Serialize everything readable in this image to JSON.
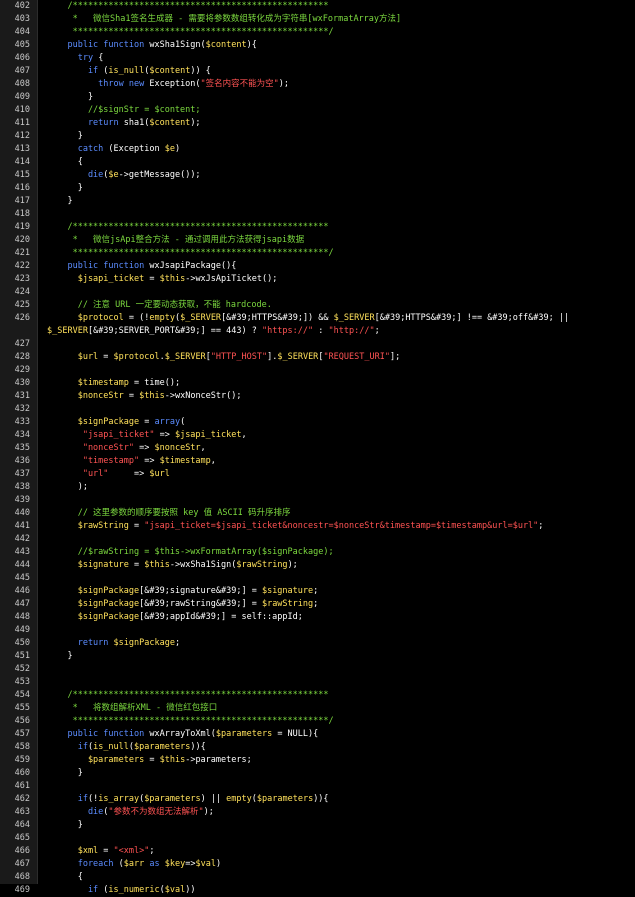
{
  "editor": {
    "language": "php",
    "colors": {
      "background": "#000000",
      "gutter": "#1a1a1a",
      "line_number": "#c8c8c8",
      "plain": "#ffffff",
      "comment": "#7cd93f",
      "keyword": "#5b8cff",
      "variable": "#ffe15b",
      "string": "#ff5353"
    },
    "lines": [
      {
        "n": "402",
        "tokens": [
          [
            "c",
            "    /**************************************************"
          ]
        ]
      },
      {
        "n": "403",
        "tokens": [
          [
            "c",
            "     *   微信Sha1签名生成器 - 需要将参数数组转化成为字符串[wxFormatArray方法]"
          ]
        ]
      },
      {
        "n": "404",
        "tokens": [
          [
            "c",
            "     **************************************************/"
          ]
        ]
      },
      {
        "n": "405",
        "tokens": [
          [
            "k",
            "    public function "
          ],
          [
            "p",
            "wxSha1Sign("
          ],
          [
            "v",
            "$content"
          ],
          [
            "p",
            "){"
          ]
        ]
      },
      {
        "n": "406",
        "tokens": [
          [
            "k",
            "      try "
          ],
          [
            "p",
            "{"
          ]
        ]
      },
      {
        "n": "407",
        "tokens": [
          [
            "k",
            "        if "
          ],
          [
            "p",
            "("
          ],
          [
            "v",
            "is_null"
          ],
          [
            "p",
            "("
          ],
          [
            "v",
            "$content"
          ],
          [
            "p",
            ")) {"
          ]
        ]
      },
      {
        "n": "408",
        "tokens": [
          [
            "k",
            "          throw new "
          ],
          [
            "p",
            "Exception("
          ],
          [
            "s",
            "\"签名内容不能为空\""
          ],
          [
            "p",
            ");"
          ]
        ]
      },
      {
        "n": "409",
        "tokens": [
          [
            "p",
            "        }"
          ]
        ]
      },
      {
        "n": "410",
        "tokens": [
          [
            "c",
            "        //$signStr = $content;"
          ]
        ]
      },
      {
        "n": "411",
        "tokens": [
          [
            "k",
            "        return "
          ],
          [
            "p",
            "sha1("
          ],
          [
            "v",
            "$content"
          ],
          [
            "p",
            ");"
          ]
        ]
      },
      {
        "n": "412",
        "tokens": [
          [
            "p",
            "      }"
          ]
        ]
      },
      {
        "n": "413",
        "tokens": [
          [
            "k",
            "      catch "
          ],
          [
            "p",
            "(Exception "
          ],
          [
            "v",
            "$e"
          ],
          [
            "p",
            ")"
          ]
        ]
      },
      {
        "n": "414",
        "tokens": [
          [
            "p",
            "      {"
          ]
        ]
      },
      {
        "n": "415",
        "tokens": [
          [
            "k",
            "        die"
          ],
          [
            "p",
            "("
          ],
          [
            "v",
            "$e"
          ],
          [
            "p",
            "->getMessage());"
          ]
        ]
      },
      {
        "n": "416",
        "tokens": [
          [
            "p",
            "      }"
          ]
        ]
      },
      {
        "n": "417",
        "tokens": [
          [
            "p",
            "    }"
          ]
        ]
      },
      {
        "n": "418",
        "tokens": []
      },
      {
        "n": "419",
        "tokens": [
          [
            "c",
            "    /**************************************************"
          ]
        ]
      },
      {
        "n": "420",
        "tokens": [
          [
            "c",
            "     *   微信jsApi整合方法 - 通过调用此方法获得jsapi数据"
          ]
        ]
      },
      {
        "n": "421",
        "tokens": [
          [
            "c",
            "     **************************************************/"
          ]
        ]
      },
      {
        "n": "422",
        "tokens": [
          [
            "k",
            "    public function "
          ],
          [
            "p",
            "wxJsapiPackage(){"
          ]
        ]
      },
      {
        "n": "423",
        "tokens": [
          [
            "v",
            "      $jsapi_ticket "
          ],
          [
            "p",
            "= "
          ],
          [
            "v",
            "$this"
          ],
          [
            "p",
            "->wxJsApiTicket();"
          ]
        ]
      },
      {
        "n": "424",
        "tokens": []
      },
      {
        "n": "425",
        "tokens": [
          [
            "c",
            "      // 注意 URL 一定要动态获取，不能 hardcode."
          ]
        ]
      },
      {
        "n": "426",
        "wrap": true,
        "tokens": [
          [
            "v",
            "      $protocol "
          ],
          [
            "p",
            "= (!"
          ],
          [
            "v",
            "empty"
          ],
          [
            "p",
            "("
          ],
          [
            "v",
            "$_SERVER"
          ],
          [
            "p",
            "[&#39;HTTPS&#39;]) && "
          ],
          [
            "v",
            "$_SERVER"
          ],
          [
            "p",
            "[&#39;HTTPS&#39;] !== &#39;off&#39; || "
          ],
          [
            "v",
            "$_SERVER"
          ],
          [
            "p",
            "[&#39;SERVER_PORT&#39;] == 443) ? "
          ],
          [
            "s",
            "\"https://\""
          ],
          [
            "p",
            " : "
          ],
          [
            "s",
            "\"http://\""
          ],
          [
            "p",
            ";"
          ]
        ]
      },
      {
        "n": "427",
        "tokens": []
      },
      {
        "n": "428",
        "tokens": [
          [
            "v",
            "      $url "
          ],
          [
            "p",
            "= "
          ],
          [
            "v",
            "$protocol"
          ],
          [
            "p",
            "."
          ],
          [
            "v",
            "$_SERVER"
          ],
          [
            "p",
            "["
          ],
          [
            "s",
            "\"HTTP_HOST\""
          ],
          [
            "p",
            "]."
          ],
          [
            "v",
            "$_SERVER"
          ],
          [
            "p",
            "["
          ],
          [
            "s",
            "\"REQUEST_URI\""
          ],
          [
            "p",
            "];"
          ]
        ]
      },
      {
        "n": "429",
        "tokens": []
      },
      {
        "n": "430",
        "tokens": [
          [
            "v",
            "      $timestamp "
          ],
          [
            "p",
            "= time();"
          ]
        ]
      },
      {
        "n": "431",
        "tokens": [
          [
            "v",
            "      $nonceStr "
          ],
          [
            "p",
            "= "
          ],
          [
            "v",
            "$this"
          ],
          [
            "p",
            "->wxNonceStr();"
          ]
        ]
      },
      {
        "n": "432",
        "tokens": []
      },
      {
        "n": "433",
        "tokens": [
          [
            "v",
            "      $signPackage "
          ],
          [
            "p",
            "= "
          ],
          [
            "k",
            "array"
          ],
          [
            "p",
            "("
          ]
        ]
      },
      {
        "n": "434",
        "tokens": [
          [
            "s",
            "       \"jsapi_ticket\" "
          ],
          [
            "p",
            "=> "
          ],
          [
            "v",
            "$jsapi_ticket"
          ],
          [
            "p",
            ","
          ]
        ]
      },
      {
        "n": "435",
        "tokens": [
          [
            "s",
            "       \"nonceStr\" "
          ],
          [
            "p",
            "=> "
          ],
          [
            "v",
            "$nonceStr"
          ],
          [
            "p",
            ","
          ]
        ]
      },
      {
        "n": "436",
        "tokens": [
          [
            "s",
            "       \"timestamp\" "
          ],
          [
            "p",
            "=> "
          ],
          [
            "v",
            "$timestamp"
          ],
          [
            "p",
            ","
          ]
        ]
      },
      {
        "n": "437",
        "tokens": [
          [
            "s",
            "       \"url\"     "
          ],
          [
            "p",
            "=> "
          ],
          [
            "v",
            "$url"
          ]
        ]
      },
      {
        "n": "438",
        "tokens": [
          [
            "p",
            "      );"
          ]
        ]
      },
      {
        "n": "439",
        "tokens": []
      },
      {
        "n": "440",
        "tokens": [
          [
            "c",
            "      // 这里参数的顺序要按照 key 值 ASCII 码升序排序"
          ]
        ]
      },
      {
        "n": "441",
        "tokens": [
          [
            "v",
            "      $rawString "
          ],
          [
            "p",
            "= "
          ],
          [
            "s",
            "\"jsapi_ticket=$jsapi_ticket&noncestr=$nonceStr&timestamp=$timestamp&url=$url\""
          ],
          [
            "p",
            ";"
          ]
        ]
      },
      {
        "n": "442",
        "tokens": []
      },
      {
        "n": "443",
        "tokens": [
          [
            "c",
            "      //$rawString = $this->wxFormatArray($signPackage);"
          ]
        ]
      },
      {
        "n": "444",
        "tokens": [
          [
            "v",
            "      $signature "
          ],
          [
            "p",
            "= "
          ],
          [
            "v",
            "$this"
          ],
          [
            "p",
            "->wxSha1Sign("
          ],
          [
            "v",
            "$rawString"
          ],
          [
            "p",
            ");"
          ]
        ]
      },
      {
        "n": "445",
        "tokens": []
      },
      {
        "n": "446",
        "tokens": [
          [
            "v",
            "      $signPackage"
          ],
          [
            "p",
            "[&#39;signature&#39;] = "
          ],
          [
            "v",
            "$signature"
          ],
          [
            "p",
            ";"
          ]
        ]
      },
      {
        "n": "447",
        "tokens": [
          [
            "v",
            "      $signPackage"
          ],
          [
            "p",
            "[&#39;rawString&#39;] = "
          ],
          [
            "v",
            "$rawString"
          ],
          [
            "p",
            ";"
          ]
        ]
      },
      {
        "n": "448",
        "tokens": [
          [
            "v",
            "      $signPackage"
          ],
          [
            "p",
            "[&#39;appId&#39;] = self::appId;"
          ]
        ]
      },
      {
        "n": "449",
        "tokens": []
      },
      {
        "n": "450",
        "tokens": [
          [
            "k",
            "      return "
          ],
          [
            "v",
            "$signPackage"
          ],
          [
            "p",
            ";"
          ]
        ]
      },
      {
        "n": "451",
        "tokens": [
          [
            "p",
            "    }"
          ]
        ]
      },
      {
        "n": "452",
        "tokens": []
      },
      {
        "n": "453",
        "tokens": []
      },
      {
        "n": "454",
        "tokens": [
          [
            "c",
            "    /**************************************************"
          ]
        ]
      },
      {
        "n": "455",
        "tokens": [
          [
            "c",
            "     *   将数组解析XML - 微信红包接口"
          ]
        ]
      },
      {
        "n": "456",
        "tokens": [
          [
            "c",
            "     **************************************************/"
          ]
        ]
      },
      {
        "n": "457",
        "tokens": [
          [
            "k",
            "    public function "
          ],
          [
            "p",
            "wxArrayToXml("
          ],
          [
            "v",
            "$parameters "
          ],
          [
            "p",
            "= NULL){"
          ]
        ]
      },
      {
        "n": "458",
        "tokens": [
          [
            "k",
            "      if"
          ],
          [
            "p",
            "("
          ],
          [
            "v",
            "is_null"
          ],
          [
            "p",
            "("
          ],
          [
            "v",
            "$parameters"
          ],
          [
            "p",
            ")){"
          ]
        ]
      },
      {
        "n": "459",
        "tokens": [
          [
            "v",
            "        $parameters "
          ],
          [
            "p",
            "= "
          ],
          [
            "v",
            "$this"
          ],
          [
            "p",
            "->parameters;"
          ]
        ]
      },
      {
        "n": "460",
        "tokens": [
          [
            "p",
            "      }"
          ]
        ]
      },
      {
        "n": "461",
        "tokens": []
      },
      {
        "n": "462",
        "tokens": [
          [
            "k",
            "      if"
          ],
          [
            "p",
            "(!"
          ],
          [
            "v",
            "is_array"
          ],
          [
            "p",
            "("
          ],
          [
            "v",
            "$parameters"
          ],
          [
            "p",
            ") || "
          ],
          [
            "v",
            "empty"
          ],
          [
            "p",
            "("
          ],
          [
            "v",
            "$parameters"
          ],
          [
            "p",
            ")){"
          ]
        ]
      },
      {
        "n": "463",
        "tokens": [
          [
            "k",
            "        die"
          ],
          [
            "p",
            "("
          ],
          [
            "s",
            "\"参数不为数组无法解析\""
          ],
          [
            "p",
            ");"
          ]
        ]
      },
      {
        "n": "464",
        "tokens": [
          [
            "p",
            "      }"
          ]
        ]
      },
      {
        "n": "465",
        "tokens": []
      },
      {
        "n": "466",
        "tokens": [
          [
            "v",
            "      $xml "
          ],
          [
            "p",
            "= "
          ],
          [
            "s",
            "\"<xml>\""
          ],
          [
            "p",
            ";"
          ]
        ]
      },
      {
        "n": "467",
        "tokens": [
          [
            "k",
            "      foreach "
          ],
          [
            "p",
            "("
          ],
          [
            "v",
            "$arr "
          ],
          [
            "k",
            "as "
          ],
          [
            "v",
            "$key"
          ],
          [
            "p",
            "=>"
          ],
          [
            "v",
            "$val"
          ],
          [
            "p",
            ")"
          ]
        ]
      },
      {
        "n": "468",
        "tokens": [
          [
            "p",
            "      {"
          ]
        ]
      },
      {
        "n": "469",
        "tokens": [
          [
            "k",
            "        if "
          ],
          [
            "p",
            "("
          ],
          [
            "v",
            "is_numeric"
          ],
          [
            "p",
            "("
          ],
          [
            "v",
            "$val"
          ],
          [
            "p",
            "))"
          ]
        ]
      }
    ]
  }
}
